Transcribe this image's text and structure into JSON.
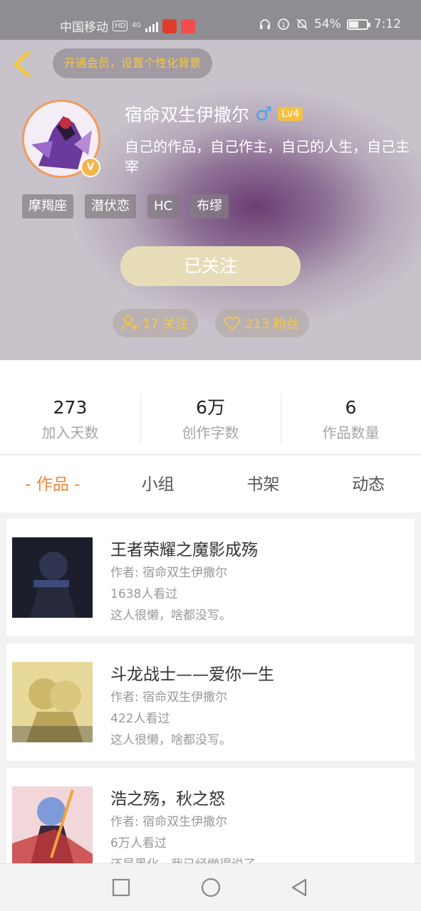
{
  "status_bar": {
    "carrier": "中国移动",
    "hd": "HD",
    "network": "4G",
    "battery": "54%",
    "time": "7:12"
  },
  "header": {
    "vip_prompt": "开通会员，设置个性化背景",
    "username": "宿命双生伊撒尔",
    "gender_symbol": "♂",
    "level": "Lv4",
    "bio": "自己的作品，自己作主，自己的人生，自己主宰",
    "tags": [
      "摩羯座",
      "潜伏恋",
      "HC",
      "布缪"
    ],
    "follow_button": "已关注",
    "following": "17 关注",
    "fans": "213 粉丝"
  },
  "stats": [
    {
      "value": "273",
      "label": "加入天数"
    },
    {
      "value": "6万",
      "label": "创作字数"
    },
    {
      "value": "6",
      "label": "作品数量"
    }
  ],
  "tabs": [
    "- 作品 -",
    "小组",
    "书架",
    "动态"
  ],
  "works": [
    {
      "title": "王者荣耀之魔影成殇",
      "author": "作者: 宿命双生伊撒尔",
      "views": "1638人看过",
      "desc": "这人很懒，啥都没写。"
    },
    {
      "title": "斗龙战士——爱你一生",
      "author": "作者: 宿命双生伊撒尔",
      "views": "422人看过",
      "desc": "这人很懒，啥都没写。"
    },
    {
      "title": "浩之殇，秋之怒",
      "author": "作者: 宿命双生伊撒尔",
      "views": "6万人看过",
      "desc": "还是黑化，我已经懒得说了"
    }
  ],
  "colors": {
    "accent": "#f0873c",
    "gold": "#f5c93d",
    "follow_button": "#e6ddb8",
    "gender_blue": "#4da3e8"
  }
}
